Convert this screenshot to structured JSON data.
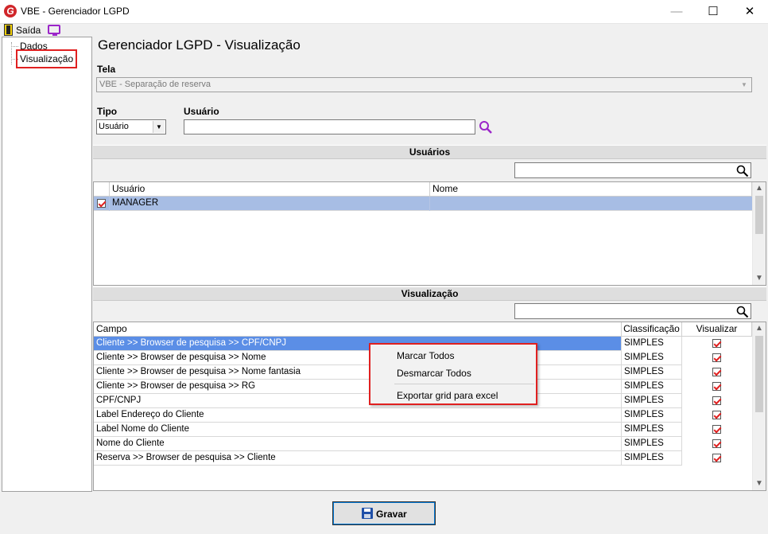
{
  "window": {
    "title": "VBE - Gerenciador LGPD",
    "logo_letter": "G"
  },
  "toolbar": {
    "exit_label": "Saída"
  },
  "tree": {
    "items": [
      "Dados",
      "Visualização"
    ]
  },
  "page": {
    "title": "Gerenciador LGPD - Visualização",
    "tela_label": "Tela",
    "tela_value": "VBE - Separação de reserva",
    "tipo_label": "Tipo",
    "tipo_value": "Usuário",
    "usuario_label": "Usuário",
    "usuario_value": ""
  },
  "usuarios": {
    "header": "Usuários",
    "search_value": "",
    "columns": [
      "Usuário",
      "Nome"
    ],
    "rows": [
      {
        "checked": true,
        "usuario": "MANAGER",
        "nome": ""
      }
    ]
  },
  "visualizacao": {
    "header": "Visualização",
    "search_value": "",
    "columns": [
      "Campo",
      "Classificação",
      "Visualizar"
    ],
    "rows": [
      {
        "campo": "Cliente >> Browser de pesquisa >> CPF/CNPJ",
        "classificacao": "SIMPLES",
        "visualizar": true
      },
      {
        "campo": "Cliente >> Browser de pesquisa >> Nome",
        "classificacao": "SIMPLES",
        "visualizar": true
      },
      {
        "campo": "Cliente >> Browser de pesquisa >> Nome fantasia",
        "classificacao": "SIMPLES",
        "visualizar": true
      },
      {
        "campo": "Cliente >> Browser de pesquisa >> RG",
        "classificacao": "SIMPLES",
        "visualizar": true
      },
      {
        "campo": "CPF/CNPJ",
        "classificacao": "SIMPLES",
        "visualizar": true
      },
      {
        "campo": "Label Endereço do Cliente",
        "classificacao": "SIMPLES",
        "visualizar": true
      },
      {
        "campo": "Label Nome do Cliente",
        "classificacao": "SIMPLES",
        "visualizar": true
      },
      {
        "campo": "Nome do Cliente",
        "classificacao": "SIMPLES",
        "visualizar": true
      },
      {
        "campo": "Reserva >> Browser de pesquisa >> Cliente",
        "classificacao": "SIMPLES",
        "visualizar": true
      }
    ]
  },
  "context_menu": {
    "items": [
      "Marcar Todos",
      "Desmarcar Todos",
      "Exportar grid para excel"
    ]
  },
  "footer": {
    "save_label": "Gravar"
  },
  "colors": {
    "selection": "#5b8ee6",
    "highlight_border": "#e02020",
    "accent_purple": "#9b26c9"
  }
}
